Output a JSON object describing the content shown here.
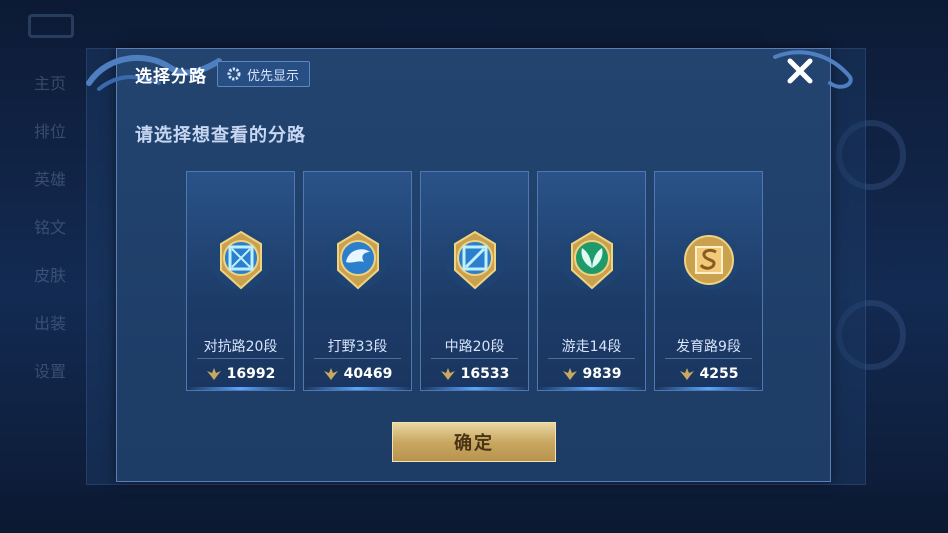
{
  "background": {
    "left_menu": [
      "主页",
      "排位",
      "英雄",
      "铭文",
      "皮肤",
      "出装",
      "设置"
    ]
  },
  "modal": {
    "title": "选择分路",
    "priority_button": "优先显示",
    "subtitle": "请选择想查看的分路",
    "confirm_button": "确定",
    "lanes": [
      {
        "role": "对抗路20段",
        "score": "16992",
        "icon": "clash-lane-icon",
        "color": "#3fb7f0"
      },
      {
        "role": "打野33段",
        "score": "40469",
        "icon": "jungle-dragon-icon",
        "color": "#3fb7f0"
      },
      {
        "role": "中路20段",
        "score": "16533",
        "icon": "mid-lane-icon",
        "color": "#3fb7f0"
      },
      {
        "role": "游走14段",
        "score": "9839",
        "icon": "roam-leaf-icon",
        "color": "#22b07a"
      },
      {
        "role": "发育路9段",
        "score": "4255",
        "icon": "farm-lane-icon",
        "color": "#d69a3a"
      }
    ]
  },
  "colors": {
    "accent_gold": "#c9a862",
    "panel_blue": "#22446f"
  }
}
